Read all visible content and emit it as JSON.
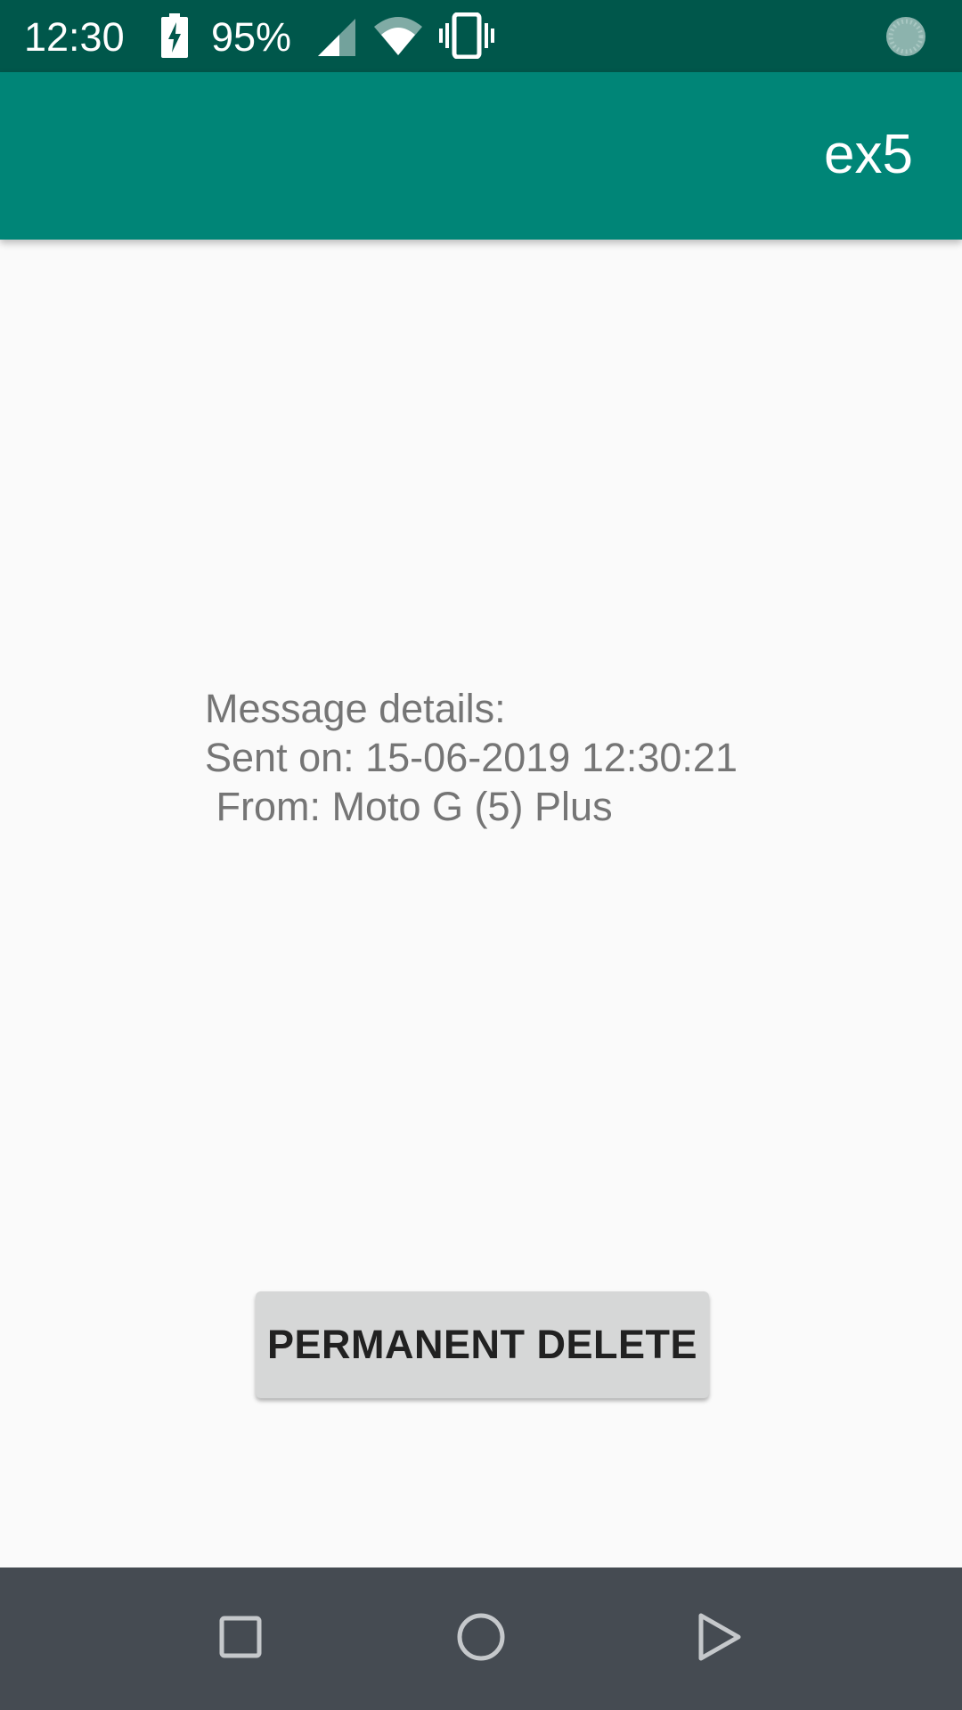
{
  "status_bar": {
    "time": "12:30",
    "battery_percent": "95%",
    "icons": [
      "battery-charging-icon",
      "signal-icon",
      "wifi-icon",
      "vibrate-icon",
      "sync-icon"
    ]
  },
  "app_bar": {
    "title": "ex5"
  },
  "content": {
    "message_details": "Message details:\nSent on: 15-06-2019 12:30:21\n From: Moto G (5) Plus",
    "delete_button_label": "PERMANENT DELETE"
  },
  "nav_bar": {
    "icons": [
      "recents-icon",
      "home-icon",
      "back-icon"
    ]
  },
  "colors": {
    "status_bar": "#00574b",
    "app_bar": "#008577",
    "background": "#fafafa",
    "text_secondary": "#757575",
    "button_bg": "#d6d7d7",
    "nav_bar": "#454b52"
  }
}
